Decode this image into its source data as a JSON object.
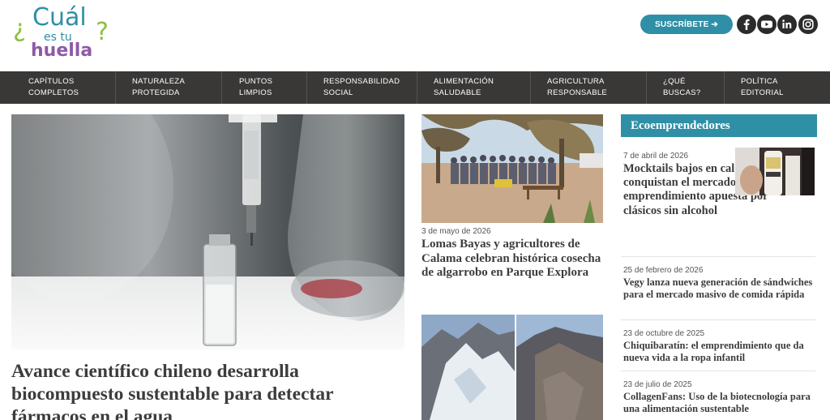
{
  "header": {
    "logo": {
      "q_open": "¿",
      "line1": "Cuál",
      "line2": "es tu",
      "line3": "huella",
      "q_close": "?"
    },
    "subscribe_label": "SUSCRÍBETE ➔",
    "social": [
      "facebook-icon",
      "youtube-icon",
      "linkedin-icon",
      "instagram-icon"
    ]
  },
  "nav": {
    "items": [
      {
        "line1": "CAPÍTULOS",
        "line2": "COMPLETOS"
      },
      {
        "line1": "NATURALEZA",
        "line2": "PROTEGIDA"
      },
      {
        "line1": "PUNTOS",
        "line2": "LIMPIOS"
      },
      {
        "line1": "RESPONSABILIDAD",
        "line2": "SOCIAL"
      },
      {
        "line1": "ALIMENTACIÓN",
        "line2": "SALUDABLE"
      },
      {
        "line1": "AGRICULTURA",
        "line2": "RESPONSABLE"
      },
      {
        "line1": "¿QUÉ",
        "line2": "BUSCAS?"
      },
      {
        "line1": "POLÍTICA",
        "line2": "EDITORIAL"
      }
    ]
  },
  "main": {
    "title": "Avance científico chileno desarrolla biocompuesto sustentable para detectar fármacos en el agua"
  },
  "middle": {
    "date": "3 de mayo de 2026",
    "title": "Lomas Bayas y agricultores de Calama celebran histórica cosecha de algarrobo en Parque Explora"
  },
  "sidebar": {
    "heading": "Ecoemprendedores",
    "items": [
      {
        "date": "7 de abril de 2026",
        "title": "Mocktails bajos en calorías conquistan el mercado nacional: emprendimiento apuesta por clásicos sin alcohol"
      },
      {
        "date": "25 de febrero de 2026",
        "title": "Vegy lanza nueva generación de sándwiches para el mercado masivo de comida rápida"
      },
      {
        "date": "23 de octubre de 2025",
        "title": "Chiquibaratín: el emprendimiento que da nueva vida a la ropa infantil"
      },
      {
        "date": "23 de julio de 2025",
        "title": "CollagenFans: Uso de la biotecnología para una alimentación sustentable"
      }
    ]
  },
  "colors": {
    "accent": "#2f8fa6",
    "nav_bg": "#3a3837",
    "logo_green": "#8fbf3f",
    "logo_purple": "#8e5aa6"
  }
}
